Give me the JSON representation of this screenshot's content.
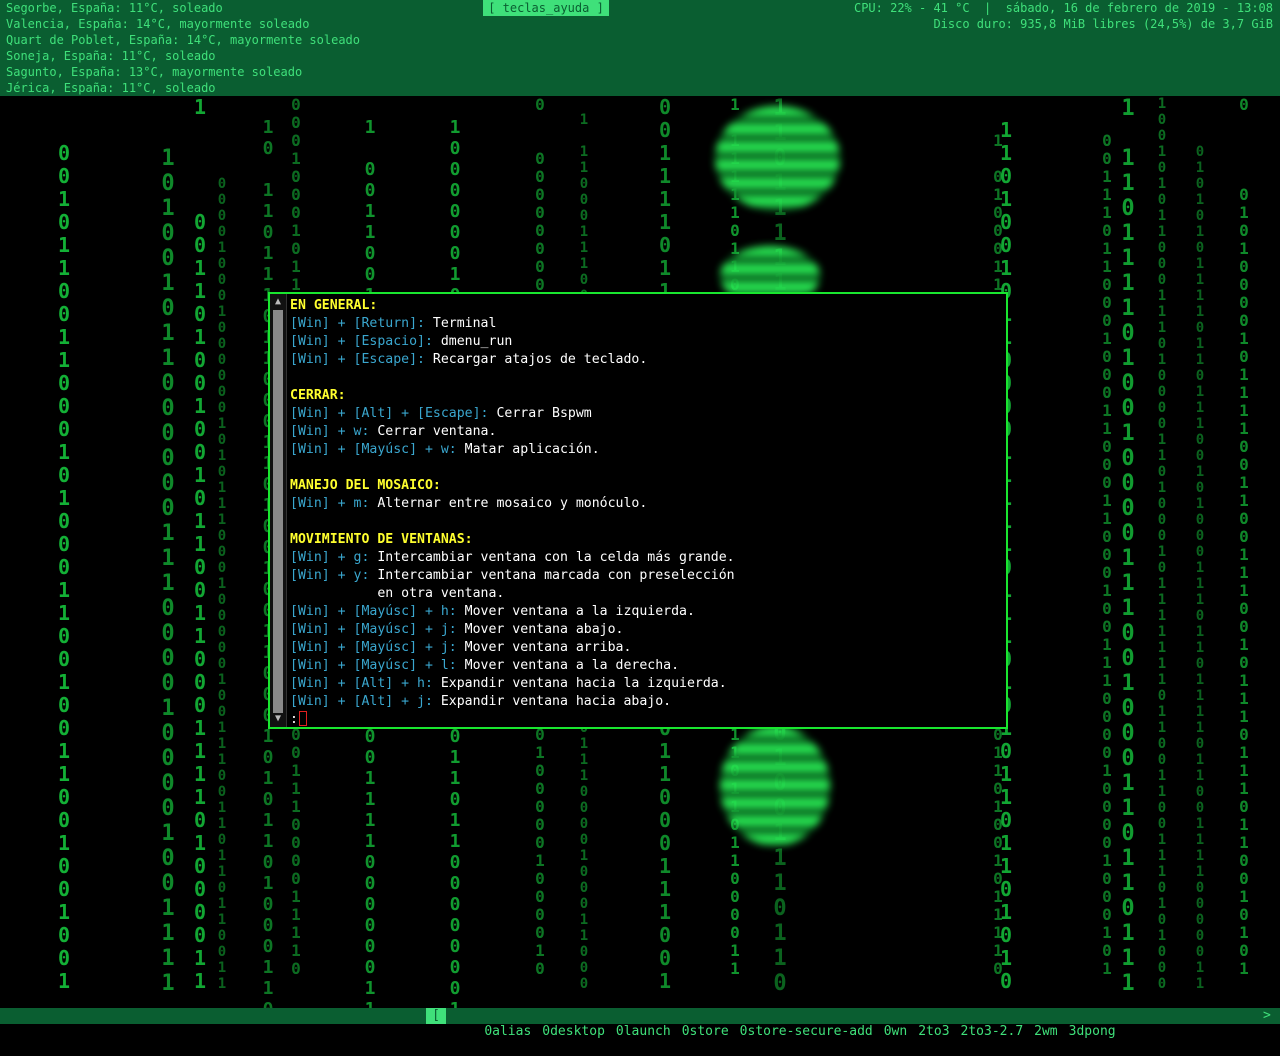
{
  "top_bar": {
    "weather": [
      "Segorbe, España: 11°C, soleado",
      "Valencia, España: 14°C, mayormente soleado",
      "Quart de Poblet, España: 14°C, mayormente soleado",
      "Soneja, España: 11°C, soleado",
      "Sagunto, España: 13°C, mayormente soleado",
      "Jérica, España: 11°C, soleado"
    ],
    "help_tag": "[ teclas_ayuda ]",
    "status_line": "CPU: 22% - 41 °C  |  sábado, 16 de febrero de 2019 - 13:08",
    "disk_line": "Disco duro: 935,8 MiB libres (24,5%) de 3,7 GiB"
  },
  "popup": {
    "lines": [
      {
        "type": "heading",
        "text": "EN GENERAL:"
      },
      {
        "type": "item",
        "key": "[Win] + [Return]:",
        "desc": " Terminal"
      },
      {
        "type": "item",
        "key": "[Win] + [Espacio]:",
        "desc": " dmenu_run"
      },
      {
        "type": "item",
        "key": "[Win] + [Escape]:",
        "desc": " Recargar atajos de teclado."
      },
      {
        "type": "blank"
      },
      {
        "type": "heading",
        "text": "CERRAR:"
      },
      {
        "type": "item",
        "key": "[Win] + [Alt] + [Escape]:",
        "desc": " Cerrar Bspwm"
      },
      {
        "type": "item",
        "key": "[Win] + w:",
        "desc": " Cerrar ventana."
      },
      {
        "type": "item",
        "key": "[Win] + [Mayúsc] + w:",
        "desc": " Matar aplicación."
      },
      {
        "type": "blank"
      },
      {
        "type": "heading",
        "text": "MANEJO DEL MOSAICO:"
      },
      {
        "type": "item",
        "key": "[Win] + m:",
        "desc": " Alternar entre mosaico y monóculo."
      },
      {
        "type": "blank"
      },
      {
        "type": "heading",
        "text": "MOVIMIENTO DE VENTANAS:"
      },
      {
        "type": "item",
        "key": "[Win] + g:",
        "desc": " Intercambiar ventana con la celda más grande."
      },
      {
        "type": "item",
        "key": "[Win] + y:",
        "desc": " Intercambiar ventana marcada con preselección"
      },
      {
        "type": "cont",
        "desc": "           en otra ventana."
      },
      {
        "type": "item",
        "key": "[Win] + [Mayúsc] + h:",
        "desc": " Mover ventana a la izquierda."
      },
      {
        "type": "item",
        "key": "[Win] + [Mayúsc] + j:",
        "desc": " Mover ventana abajo."
      },
      {
        "type": "item",
        "key": "[Win] + [Mayúsc] + j:",
        "desc": " Mover ventana arriba."
      },
      {
        "type": "item",
        "key": "[Win] + [Mayúsc] + l:",
        "desc": " Mover ventana a la derecha."
      },
      {
        "type": "item",
        "key": "[Win] + [Alt] + h:",
        "desc": " Expandir ventana hacia la izquierda."
      },
      {
        "type": "item",
        "key": "[Win] + [Alt] + j:",
        "desc": " Expandir ventana hacia abajo."
      }
    ],
    "prompt": ":"
  },
  "bottom_bar": {
    "bracket": "[",
    "programs": [
      "0alias",
      "0desktop",
      "0launch",
      "0store",
      "0store-secure-add",
      "0wn",
      "2to3",
      "2to3-2.7",
      "2wm",
      "3dpong"
    ],
    "arrow": ">"
  },
  "colors": {
    "bar_background": "#0a5e31",
    "bar_text": "#3fe07a",
    "popup_border": "#19e62f",
    "heading": "#ffff2e",
    "key": "#3aa7cf",
    "matrix_green": "#16c43c"
  }
}
